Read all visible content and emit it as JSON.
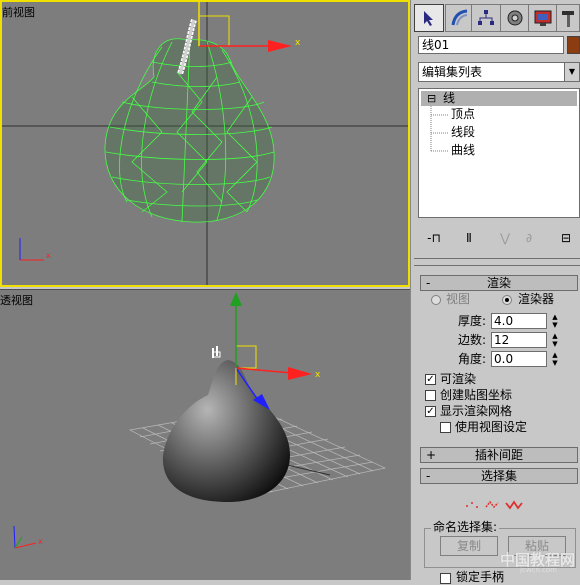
{
  "viewports": {
    "front": {
      "label": "前视图",
      "axis_x": "x"
    },
    "perspective": {
      "label": "透视图",
      "axis_x": "x"
    }
  },
  "toolbar": {
    "tabs": [
      {
        "name": "create-tab",
        "icon": "cursor-arrow-icon",
        "active": true
      },
      {
        "name": "modify-tab",
        "icon": "modify-arc-icon",
        "active": false
      },
      {
        "name": "hierarchy-tab",
        "icon": "hierarchy-icon",
        "active": false
      },
      {
        "name": "motion-tab",
        "icon": "motion-wheel-icon",
        "active": false
      },
      {
        "name": "display-tab",
        "icon": "display-monitor-icon",
        "active": false
      },
      {
        "name": "utilities-tab",
        "icon": "hammer-icon",
        "active": false
      }
    ]
  },
  "object": {
    "name": "线01",
    "color": "#8b3c10"
  },
  "modifier_list": {
    "label": "编辑集列表"
  },
  "stack": {
    "root": "线",
    "toggle": "⊟",
    "subobjects": [
      "顶点",
      "线段",
      "曲线"
    ]
  },
  "stack_tools": {
    "pin": "-⊓",
    "show_end": "Ⅱ",
    "unique": "⋁",
    "remove": "∂",
    "config": "⊟"
  },
  "rendering": {
    "rollout_sign": "-",
    "title": "渲染",
    "viewport_label": "视图",
    "renderer_label": "渲染器",
    "thickness_label": "厚度:",
    "thickness": "4.0",
    "sides_label": "边数:",
    "sides": "12",
    "angle_label": "角度:",
    "angle": "0.0",
    "renderable": "可渲染",
    "gen_mapping": "创建贴图坐标",
    "display_mesh": "显示渲染网格",
    "use_viewport": "使用视图设定"
  },
  "interpolation": {
    "sign": "+",
    "title": "插补间距"
  },
  "selection": {
    "sign": "-",
    "title": "选择集",
    "named_label": "命名选择集:",
    "copy": "复制",
    "paste": "粘贴",
    "lock_handles": "锁定手柄"
  },
  "watermark": {
    "text": "中国教程网",
    "sub": "jcwcn.com"
  },
  "colors": {
    "viewport_bg": "#7d7d7d",
    "active_border": "#f0e000",
    "wire": "#44ff44",
    "gizmo_x": "#ff2020",
    "gizmo_y": "#20a020",
    "gizmo_z": "#2020ff"
  }
}
